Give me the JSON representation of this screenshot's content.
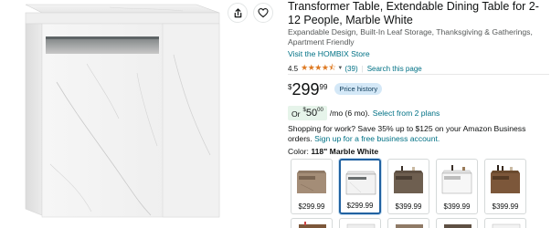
{
  "product": {
    "title": "Transformer Table, Extendable Dining Table for 2-12 People, Marble White",
    "subtitle": "Expandable Design, Built-In Leaf Storage, Thanksgiving & Gatherings, Apartment Friendly",
    "store_link": "Visit the HOMBIX Store",
    "rating": "4.5",
    "stars": "★★★★⯪",
    "review_count": "(39)",
    "separator": "|",
    "search_link": "Search this page"
  },
  "price": {
    "symbol": "$",
    "whole": "299",
    "fraction": "99",
    "history_label": "Price history"
  },
  "monthly": {
    "or_label": "Or",
    "symbol": "$",
    "whole": "50",
    "fraction": "00",
    "term": "/mo (6 mo).",
    "select_label": "Select from 2 plans"
  },
  "business": {
    "text": "Shopping for work? Save 35% up to $125 on your Amazon Business orders.",
    "link": "Sign up for a free business account."
  },
  "color": {
    "label": "Color:",
    "value": "118\" Marble White"
  },
  "swatches": [
    {
      "price": "$299.99",
      "selected": false
    },
    {
      "price": "$299.99",
      "selected": true
    },
    {
      "price": "$399.99",
      "selected": false
    },
    {
      "price": "$399.99",
      "selected": false
    },
    {
      "price": "$399.99",
      "selected": false
    }
  ],
  "icons": {
    "share": "share-icon",
    "favorite": "heart-icon"
  },
  "colors": {
    "link": "#007185",
    "star": "#de7921",
    "selected_border": "#2162a1",
    "history_bg": "#d4e8f7",
    "monthly_bg": "#e6f4ea"
  }
}
